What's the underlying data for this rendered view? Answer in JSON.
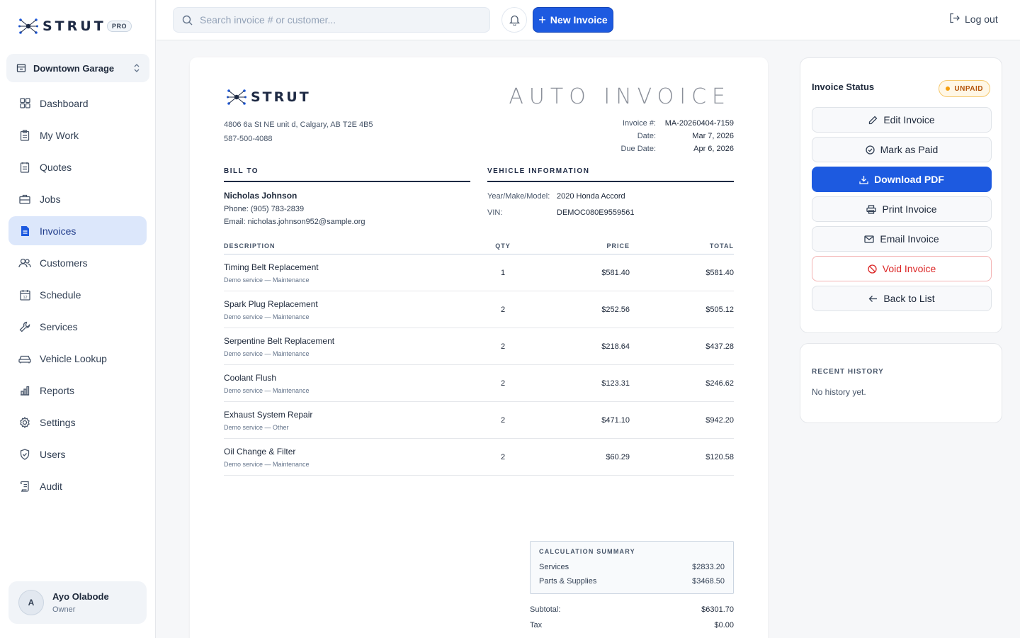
{
  "brand": {
    "name": "STRUT",
    "tier": "PRO"
  },
  "location": {
    "name": "Downtown Garage"
  },
  "nav": {
    "items": [
      {
        "label": "Dashboard",
        "icon": "dashboard-icon"
      },
      {
        "label": "My Work",
        "icon": "clipboard-icon"
      },
      {
        "label": "Quotes",
        "icon": "quote-icon"
      },
      {
        "label": "Jobs",
        "icon": "briefcase-icon"
      },
      {
        "label": "Invoices",
        "icon": "invoice-icon",
        "active": true
      },
      {
        "label": "Customers",
        "icon": "users-icon"
      },
      {
        "label": "Schedule",
        "icon": "calendar-icon"
      },
      {
        "label": "Services",
        "icon": "wrench-icon"
      },
      {
        "label": "Vehicle Lookup",
        "icon": "car-icon"
      },
      {
        "label": "Reports",
        "icon": "bar-chart-icon"
      },
      {
        "label": "Settings",
        "icon": "gear-icon"
      },
      {
        "label": "Users",
        "icon": "shield-icon"
      },
      {
        "label": "Audit",
        "icon": "audit-icon"
      }
    ]
  },
  "user": {
    "initial": "A",
    "name": "Ayo Olabode",
    "role": "Owner"
  },
  "topbar": {
    "search_placeholder": "Search invoice # or customer...",
    "new_invoice_label": "New Invoice",
    "logout_label": "Log out"
  },
  "invoice": {
    "title": "AUTO INVOICE",
    "company": {
      "name": "STRUT",
      "address": "4806 6a St NE unit d, Calgary, AB T2E 4B5",
      "phone": "587-500-4088"
    },
    "meta": [
      {
        "label": "Invoice #:",
        "value": "MA-20260404-7159"
      },
      {
        "label": "Date:",
        "value": "Mar 7, 2026"
      },
      {
        "label": "Due Date:",
        "value": "Apr 6, 2026"
      }
    ],
    "bill_to": {
      "heading": "BILL TO",
      "name": "Nicholas Johnson",
      "phone": "Phone: (905) 783-2839",
      "email": "Email: nicholas.johnson952@sample.org"
    },
    "vehicle": {
      "heading": "VEHICLE INFORMATION",
      "rows": [
        {
          "label": "Year/Make/Model:",
          "value": "2020 Honda Accord"
        },
        {
          "label": "VIN:",
          "value": "DEMOC080E9559561"
        }
      ]
    },
    "columns": {
      "description": "DESCRIPTION",
      "qty": "QTY",
      "price": "PRICE",
      "total": "TOTAL"
    },
    "items": [
      {
        "name": "Timing Belt Replacement",
        "sub": "Demo service — Maintenance",
        "qty": "1",
        "price": "$581.40",
        "total": "$581.40"
      },
      {
        "name": "Spark Plug Replacement",
        "sub": "Demo service — Maintenance",
        "qty": "2",
        "price": "$252.56",
        "total": "$505.12"
      },
      {
        "name": "Serpentine Belt Replacement",
        "sub": "Demo service — Maintenance",
        "qty": "2",
        "price": "$218.64",
        "total": "$437.28"
      },
      {
        "name": "Coolant Flush",
        "sub": "Demo service — Maintenance",
        "qty": "2",
        "price": "$123.31",
        "total": "$246.62"
      },
      {
        "name": "Exhaust System Repair",
        "sub": "Demo service — Other",
        "qty": "2",
        "price": "$471.10",
        "total": "$942.20"
      },
      {
        "name": "Oil Change & Filter",
        "sub": "Demo service — Maintenance",
        "qty": "2",
        "price": "$60.29",
        "total": "$120.58"
      }
    ],
    "summary": {
      "title": "CALCULATION SUMMARY",
      "rows": [
        {
          "label": "Services",
          "value": "$2833.20"
        },
        {
          "label": "Parts & Supplies",
          "value": "$3468.50"
        }
      ]
    },
    "totals": [
      {
        "label": "Subtotal:",
        "value": "$6301.70"
      },
      {
        "label": "Tax",
        "value": "$0.00"
      }
    ]
  },
  "status_panel": {
    "heading": "Invoice Status",
    "badge": "UNPAID",
    "actions": {
      "edit": "Edit Invoice",
      "mark_paid": "Mark as Paid",
      "download": "Download PDF",
      "print": "Print Invoice",
      "email": "Email Invoice",
      "void": "Void Invoice",
      "back": "Back to List"
    }
  },
  "history": {
    "heading": "RECENT HISTORY",
    "empty": "No history yet."
  },
  "colors": {
    "primary": "#1d5ae0",
    "navy": "#1e2a44",
    "danger": "#dc2626",
    "warning": "#b45309"
  }
}
